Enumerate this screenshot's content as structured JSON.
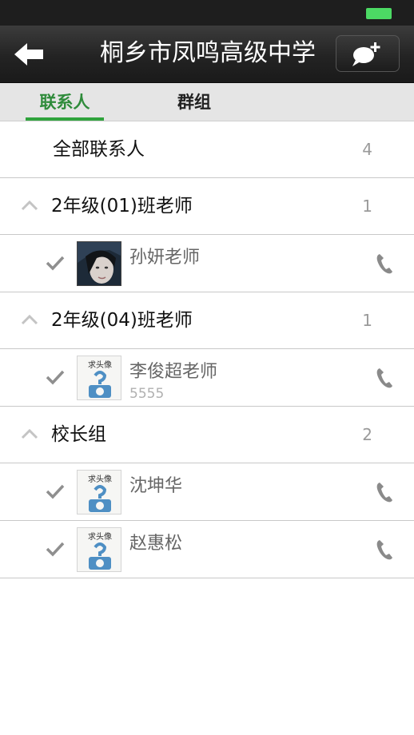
{
  "header": {
    "title": "桐乡市凤鸣高级中学"
  },
  "tabs": [
    {
      "label": "联系人",
      "active": true
    },
    {
      "label": "群组",
      "active": false
    }
  ],
  "all_contacts": {
    "label": "全部联系人",
    "count": "4"
  },
  "groups": [
    {
      "name": "2年级(01)班老师",
      "count": "1",
      "members": [
        {
          "name": "孙妍老师",
          "subtitle": "",
          "avatar": "photo"
        }
      ]
    },
    {
      "name": "2年级(04)班老师",
      "count": "1",
      "members": [
        {
          "name": "李俊超老师",
          "subtitle": "5555",
          "avatar": "placeholder"
        }
      ]
    },
    {
      "name": "校长组",
      "count": "2",
      "members": [
        {
          "name": "沈坤华",
          "subtitle": "",
          "avatar": "placeholder"
        },
        {
          "name": "赵惠松",
          "subtitle": "",
          "avatar": "placeholder"
        }
      ]
    }
  ],
  "avatar_placeholder_text": "求头像",
  "colors": {
    "accent": "#2fa33c",
    "battery": "#4cd964",
    "nav_bg": "#232323"
  },
  "icons": [
    "back-arrow-icon",
    "chat-add-icon",
    "caret-up-icon",
    "checkmark-icon",
    "phone-icon"
  ]
}
